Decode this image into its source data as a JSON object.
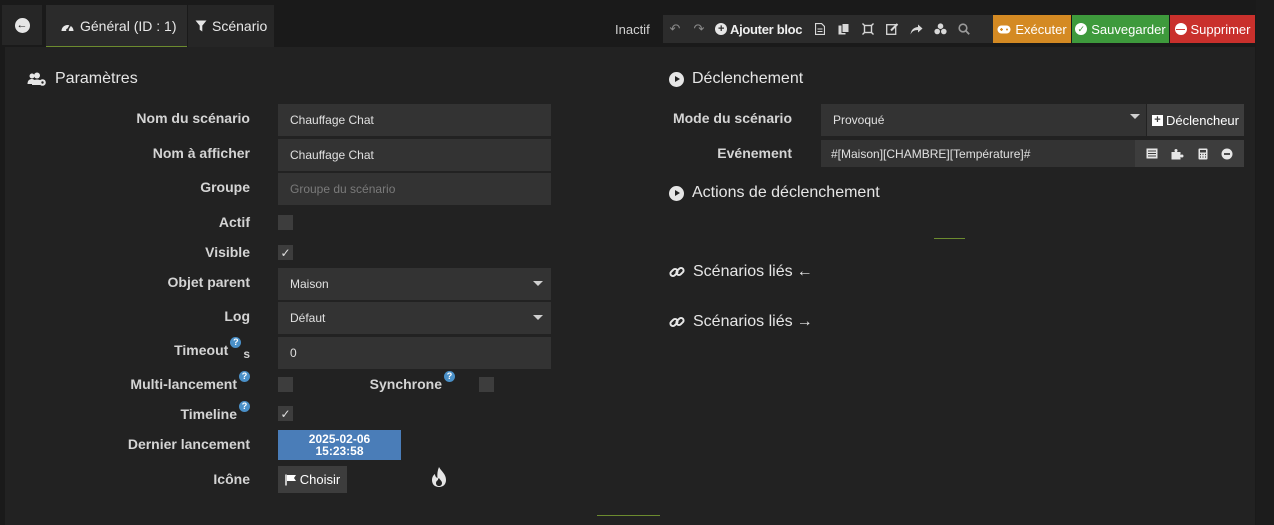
{
  "tabs": {
    "general": "Général (ID : 1)",
    "scenario": "Scénario"
  },
  "toolbar": {
    "status": "Inactif",
    "add_block": "Ajouter bloc",
    "execute": "Exécuter",
    "save": "Sauvegarder",
    "delete": "Supprimer"
  },
  "params": {
    "title": "Paramètres",
    "name_label": "Nom du scénario",
    "name_value": "Chauffage Chat",
    "display_label": "Nom à afficher",
    "display_value": "Chauffage Chat",
    "group_label": "Groupe",
    "group_placeholder": "Groupe du scénario",
    "active_label": "Actif",
    "visible_label": "Visible",
    "parent_label": "Objet parent",
    "parent_value": "Maison",
    "log_label": "Log",
    "log_value": "Défaut",
    "timeout_label": "Timeout",
    "timeout_unit": "s",
    "timeout_value": "0",
    "multi_label": "Multi-lancement",
    "sync_label": "Synchrone",
    "timeline_label": "Timeline",
    "last_run_label": "Dernier lancement",
    "last_run_date": "2025-02-06",
    "last_run_time": "15:23:58",
    "icon_label": "Icône",
    "choose_label": "Choisir"
  },
  "trigger": {
    "title": "Déclenchement",
    "mode_label": "Mode du scénario",
    "mode_value": "Provoqué",
    "trigger_btn": "Déclencheur",
    "event_label": "Evénement",
    "event_value": "#[Maison][CHAMBRE][Température]#",
    "actions_title": "Actions de déclenchement",
    "linked_in_title": "Scénarios liés",
    "linked_out_title": "Scénarios liés"
  },
  "states": {
    "active": false,
    "visible": true,
    "multi": false,
    "sync": false,
    "timeline": true
  },
  "colors": {
    "execute": "#d48a23",
    "save": "#3e9a3c",
    "delete": "#c9302c",
    "last_run": "#4a7db8"
  }
}
